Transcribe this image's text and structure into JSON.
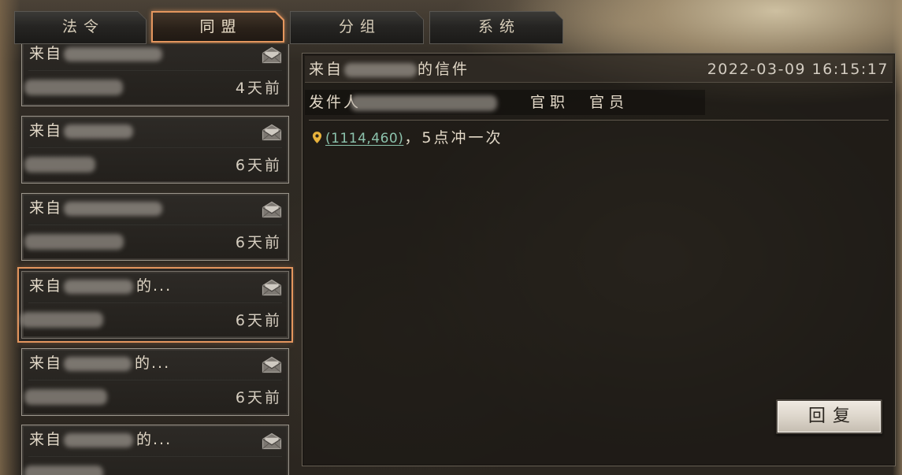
{
  "colors": {
    "accent": "#e4965e",
    "link": "#8cc3ad",
    "pin": "#e8b23c",
    "text": "#e2d8c7"
  },
  "tabs": [
    {
      "label": "法令",
      "active": false
    },
    {
      "label": "同盟",
      "active": true
    },
    {
      "label": "分组",
      "active": false
    },
    {
      "label": "系统",
      "active": false
    }
  ],
  "mail_list": {
    "items": [
      {
        "from_prefix": "来自",
        "time": "4天前",
        "icon": "envelope-icon",
        "selected": false
      },
      {
        "from_prefix": "来自",
        "time": "6天前",
        "icon": "envelope-icon",
        "selected": false
      },
      {
        "from_prefix": "来自",
        "time": "6天前",
        "icon": "envelope-icon",
        "selected": false
      },
      {
        "from_prefix": "来自",
        "from_suffix": "的...",
        "time": "6天前",
        "icon": "envelope-icon",
        "selected": true
      },
      {
        "from_prefix": "来自",
        "from_suffix": "的...",
        "time": "6天前",
        "icon": "envelope-icon",
        "selected": false
      },
      {
        "from_prefix": "来自",
        "from_suffix": "的...",
        "icon": "envelope-icon",
        "selected": false
      }
    ]
  },
  "message": {
    "title_prefix": "来自",
    "title_suffix": "的信件",
    "date": "2022-03-09 16:15:17",
    "sender_label": "发件人",
    "rank_label": "官职",
    "rank_value": "官员",
    "body": {
      "icon": "location-pin-icon",
      "coord_link": "(1114,460)",
      "text": "，5点冲一次"
    }
  },
  "reply_button": {
    "label": "回复"
  }
}
